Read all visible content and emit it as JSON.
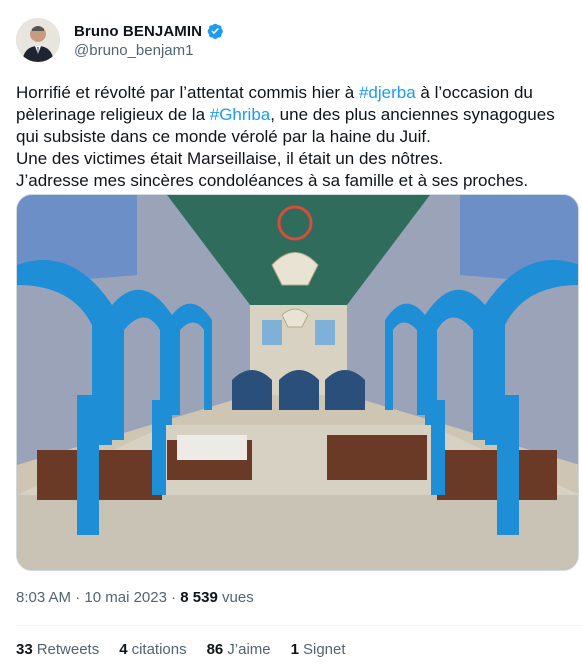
{
  "author": {
    "display_name": "Bruno BENJAMIN",
    "handle": "@bruno_benjam1",
    "verified_icon": "verified-badge-icon",
    "verified_color": "#1d9bf0"
  },
  "tweet": {
    "line1_a": "Horrifié et révolté par l’attentat commis hier à ",
    "hashtag1": "#djerba",
    "line1_b": " à l’occasion du pèlerinage religieux de la ",
    "hashtag2": "#Ghriba",
    "line1_c": ", une des plus anciennes synagogues qui subsiste dans ce monde vérolé par la haine du Juif.",
    "line2": "Une des victimes était Marseillaise, il était un des nôtres.",
    "line3": "J’adresse mes sincères condoléances à sa famille et à ses proches."
  },
  "timestamp": {
    "time": "8:03 AM",
    "sep": " · ",
    "date": "10 mai 2023",
    "sep2": " · ",
    "views_count": "8 539",
    "views_label": " vues"
  },
  "stats": {
    "retweets_count": "33",
    "retweets_label": "Retweets",
    "quotes_count": "4",
    "quotes_label": "citations",
    "likes_count": "86",
    "likes_label": "J’aime",
    "bookmarks_count": "1",
    "bookmarks_label": "Signet"
  },
  "colors": {
    "accent": "#1d9bf0",
    "secondary_text": "#536471",
    "primary_text": "#0f1419"
  }
}
